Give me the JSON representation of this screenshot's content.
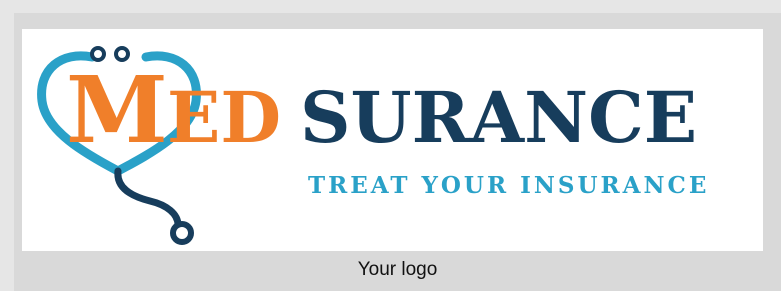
{
  "logo": {
    "brand_prefix": "M",
    "brand_middle": "ED",
    "brand_suffix": "SURANCE",
    "tagline": "TREAT YOUR INSURANCE",
    "colors": {
      "orange": "#f07f2a",
      "navy": "#173d5c",
      "teal": "#2aa1c8"
    },
    "icon": "stethoscope-heart-icon"
  },
  "caption": "Your logo"
}
